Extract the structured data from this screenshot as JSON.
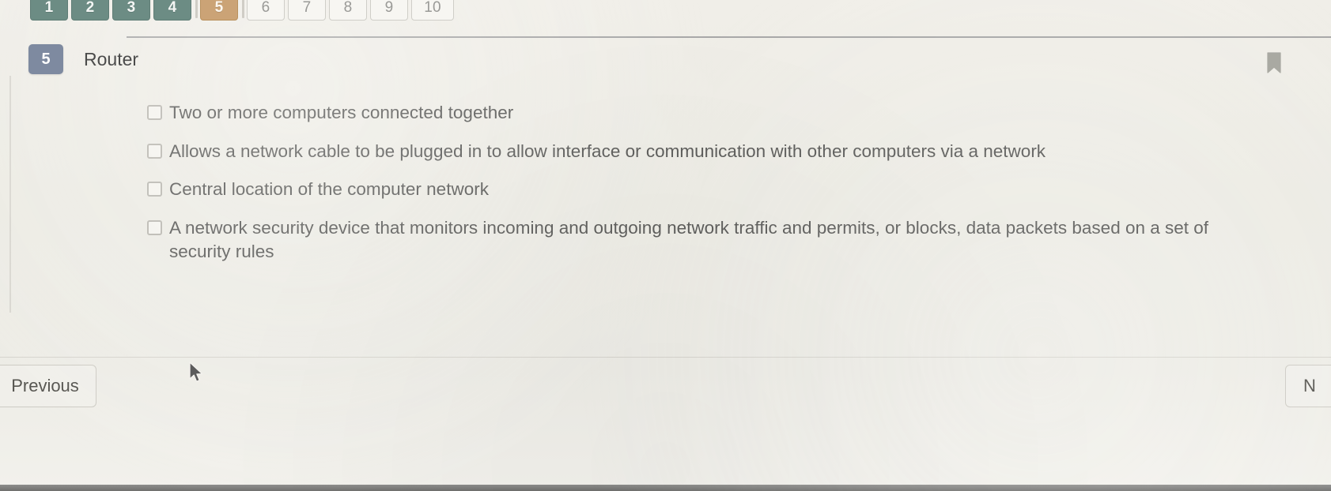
{
  "pagination": {
    "name": "question-pagination",
    "items": [
      {
        "label": "1",
        "state": "done"
      },
      {
        "label": "2",
        "state": "done"
      },
      {
        "label": "3",
        "state": "done"
      },
      {
        "label": "4",
        "state": "done"
      },
      {
        "label": "5",
        "state": "current"
      },
      {
        "label": "6",
        "state": "todo"
      },
      {
        "label": "7",
        "state": "todo"
      },
      {
        "label": "8",
        "state": "todo"
      },
      {
        "label": "9",
        "state": "todo"
      },
      {
        "label": "10",
        "state": "todo"
      }
    ]
  },
  "question": {
    "number": "5",
    "title": "Router",
    "bookmark_icon": "bookmark-icon",
    "options": [
      {
        "text": "Two or more computers connected together",
        "checked": false
      },
      {
        "text": "Allows a network cable to be plugged in to allow interface or communication with other computers via a network",
        "checked": false
      },
      {
        "text": "Central location of the computer network",
        "checked": false
      },
      {
        "text": "A network security device that monitors incoming and outgoing network traffic and permits, or blocks, data packets based on a set of security rules",
        "checked": false
      }
    ]
  },
  "footer": {
    "previous_label": "Previous",
    "next_label": "N"
  },
  "colors": {
    "answered_tab": "#6c8c84",
    "current_tab": "#cba376",
    "unanswered_tab": "#f7f6f2",
    "question_badge": "#7e8aa0",
    "page_background": "#eeece6",
    "text": "#585856"
  },
  "cursor": {
    "icon": "mouse-pointer-icon"
  }
}
